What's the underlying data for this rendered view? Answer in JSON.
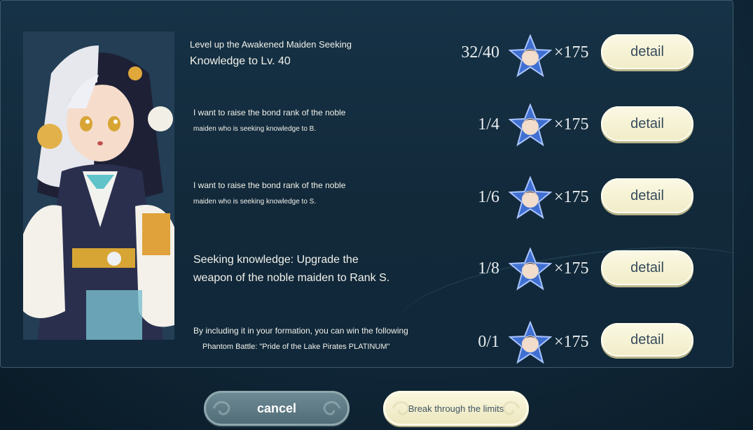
{
  "missions": [
    {
      "line1": "Level up the Awakened Maiden Seeking",
      "line2": "Knowledge to Lv. 40",
      "progress": "32/40",
      "reward_count": "×175",
      "detail_label": "detail"
    },
    {
      "line1": "I want to raise the bond rank of the noble",
      "line2": "maiden who is seeking knowledge to B.",
      "progress": "1/4",
      "reward_count": "×175",
      "detail_label": "detail"
    },
    {
      "line1": "I want to raise the bond rank of the noble",
      "line2": "maiden who is seeking knowledge to S.",
      "progress": "1/6",
      "reward_count": "×175",
      "detail_label": "detail"
    },
    {
      "line1": "Seeking knowledge: Upgrade the",
      "line2": "weapon of the noble maiden to Rank S.",
      "progress": "1/8",
      "reward_count": "×175",
      "detail_label": "detail"
    },
    {
      "line1": "By including it in your formation, you can win the following",
      "line2": "Phantom Battle: \"Pride of the Lake Pirates PLATINUM\"",
      "progress": "0/1",
      "reward_count": "×175",
      "detail_label": "detail"
    }
  ],
  "buttons": {
    "cancel": "cancel",
    "break_limits": "Break through the limits"
  },
  "icons": {
    "reward": "star-character-badge-icon",
    "portrait": "maiden-character-portrait"
  },
  "colors": {
    "panel_bg": "#12293a",
    "detail_button": "#f1ecc8",
    "cancel_button": "#5b7882",
    "star_blue": "#3f6fd1"
  }
}
